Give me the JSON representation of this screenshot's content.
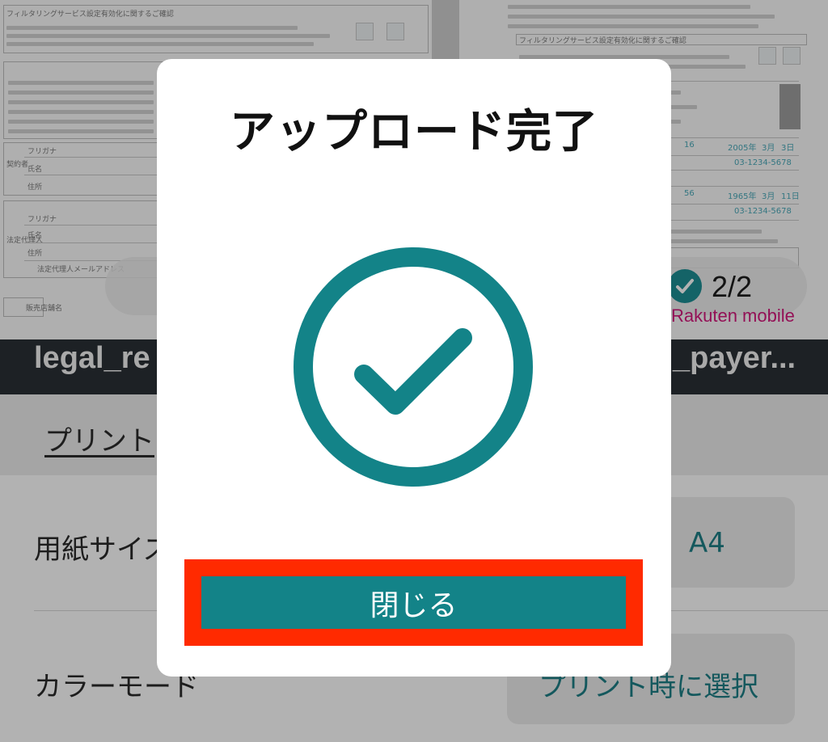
{
  "document_preview": {
    "left_page_heading": "フィルタリングサービス設定有効化に関するご確認",
    "right_page_heading": "フィルタリングサービス設定有効化に関するご確認",
    "form_labels": [
      "契約者",
      "フリガナ",
      "氏名",
      "住所",
      "法定代理人",
      "フリガナ",
      "氏名",
      "住所",
      "法定代理人メールアドレス",
      "販売店舗名"
    ],
    "right_values": [
      "16",
      "2005年",
      "3月",
      "3日",
      "03-1234-5678",
      "56",
      "1965年",
      "3月",
      "11日",
      "03-1234-5678"
    ],
    "page_indicator": "2/2",
    "brand": "Rakuten mobile"
  },
  "files": {
    "left_name": "legal_re",
    "right_name": "_payer..."
  },
  "print_link": "プリント",
  "settings": {
    "paper_size_label": "用紙サイズ",
    "paper_size_value": "A4",
    "color_mode_label": "カラーモード",
    "color_mode_value": "プリント時に選択"
  },
  "modal": {
    "title": "アップロード完了",
    "icon": "check-circle-icon",
    "close_label": "閉じる"
  },
  "colors": {
    "accent": "#138388",
    "highlight": "#ff2a00",
    "file_bar": "#2a3036"
  }
}
